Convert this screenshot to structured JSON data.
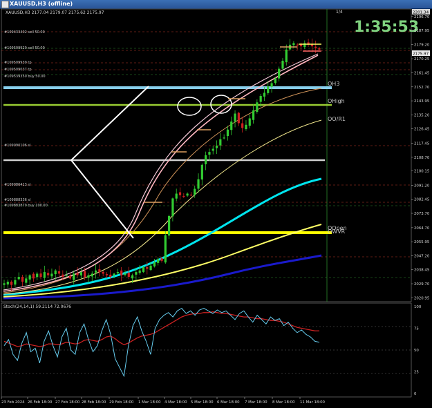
{
  "window": {
    "title": "XAUUSD,H3 (offline)"
  },
  "header": {
    "symbol_line": "XAUUSD,H3  2177.04 2179.07 2175.62 2175.97",
    "countdown": "1:35:53",
    "page_indicator": "1/4"
  },
  "colors": {
    "background": "#000000",
    "bull_candle": "#32cd32",
    "bear_candle": "#d02020",
    "countdown": "#7fd27f",
    "skyblue_level": "#87ceeb",
    "yellowgreen_level": "#9acd32",
    "yellow_level": "#ffff00",
    "white_level": "#ffffff"
  },
  "price_axis": {
    "ticks": [
      "2196.70",
      "2187.95",
      "2179.20",
      "2170.25",
      "2161.45",
      "2152.70",
      "2143.95",
      "2135.20",
      "2126.45",
      "2117.45",
      "2108.70",
      "2100.15",
      "2091.20",
      "2082.45",
      "2073.70",
      "2064.70",
      "2055.95",
      "2047.20",
      "2038.45",
      "2029.70",
      "2020.95"
    ],
    "top_label": "2201.34",
    "current_price": "2175.97"
  },
  "time_axis": {
    "labels": [
      "23 Feb 2024",
      "26 Feb 18:00",
      "27 Feb 18:00",
      "28 Feb 18:00",
      "29 Feb 18:00",
      "1 Mar 18:00",
      "4 Mar 18:00",
      "5 Mar 18:00",
      "6 Mar 18:00",
      "7 Mar 18:00",
      "8 Mar 18:00",
      "11 Mar 18:00"
    ]
  },
  "order_labels": [
    {
      "text": "#109433402 sell 50.00"
    },
    {
      "text": "#109509929 sell 50.00"
    },
    {
      "text": "#109509939 tp"
    },
    {
      "text": "#109509037 tp"
    },
    {
      "text": "#109539350 buy 50.00"
    },
    {
      "text": "#109090106 sl"
    },
    {
      "text": "#109086413 sl"
    },
    {
      "text": "#109888336 sl"
    },
    {
      "text": "#109883879 buy 100.00"
    }
  ],
  "pivot_labels": [
    "OH3",
    "OHigh",
    "OO/R1",
    "OOpen",
    "OWVR"
  ],
  "stoch": {
    "label": "Stoch(24,14,1) 59.2114 72.0676",
    "ticks": [
      "100",
      "75",
      "50",
      "25",
      "0"
    ]
  },
  "chart_data": {
    "type": "candlestick",
    "symbol": "XAUUSD",
    "timeframe": "H3",
    "ohlc_current": {
      "open": 2177.04,
      "high": 2179.07,
      "low": 2175.62,
      "close": 2175.97
    },
    "ylim": [
      2018.5,
      2201.34
    ],
    "closes": [
      2030,
      2031,
      2029,
      2032,
      2034,
      2031,
      2033,
      2035,
      2033,
      2036,
      2034,
      2037,
      2035,
      2036,
      2038,
      2036,
      2034,
      2035,
      2033,
      2036,
      2035,
      2037,
      2034,
      2035,
      2036,
      2038,
      2037,
      2036,
      2035,
      2034,
      2036,
      2037,
      2035,
      2036,
      2034,
      2035,
      2037,
      2038,
      2040,
      2039,
      2041,
      2043,
      2045,
      2044,
      2060,
      2072,
      2083,
      2086,
      2085,
      2084,
      2086,
      2085,
      2089,
      2095,
      2104,
      2110,
      2112,
      2114,
      2116,
      2120,
      2121,
      2126,
      2131,
      2136,
      2130,
      2127,
      2129,
      2133,
      2138,
      2143,
      2147,
      2149,
      2153,
      2155,
      2158,
      2164,
      2169,
      2176,
      2179,
      2180,
      2179,
      2178,
      2180,
      2179,
      2178,
      2177,
      2176
    ],
    "stochastic": {
      "params": "24,14,1",
      "main_last": 59.2114,
      "signal_last": 72.0676,
      "main": [
        55,
        62,
        45,
        38,
        58,
        70,
        48,
        52,
        35,
        60,
        72,
        55,
        42,
        65,
        75,
        50,
        45,
        70,
        80,
        62,
        48,
        55,
        72,
        85,
        68,
        40,
        30,
        20,
        55,
        78,
        88,
        72,
        60,
        45,
        75,
        85,
        90,
        93,
        88,
        95,
        98,
        92,
        95,
        90,
        96,
        98,
        95,
        92,
        96,
        93,
        95,
        90,
        85,
        92,
        95,
        88,
        82,
        90,
        85,
        80,
        88,
        84,
        86,
        78,
        82,
        75,
        70,
        73,
        68,
        65,
        60,
        59
      ],
      "signal": [
        60,
        58,
        56,
        54,
        55,
        57,
        56,
        55,
        54,
        55,
        57,
        57,
        56,
        57,
        59,
        58,
        57,
        58,
        61,
        62,
        61,
        60,
        62,
        65,
        66,
        63,
        59,
        56,
        58,
        61,
        64,
        66,
        67,
        68,
        70,
        73,
        76,
        79,
        82,
        85,
        88,
        90,
        91,
        92,
        92,
        93,
        93,
        94,
        93,
        92,
        92,
        91,
        90,
        89,
        88,
        88,
        87,
        86,
        86,
        85,
        84,
        84,
        83,
        82,
        80,
        78,
        76,
        75,
        74,
        73,
        72,
        72
      ]
    }
  }
}
